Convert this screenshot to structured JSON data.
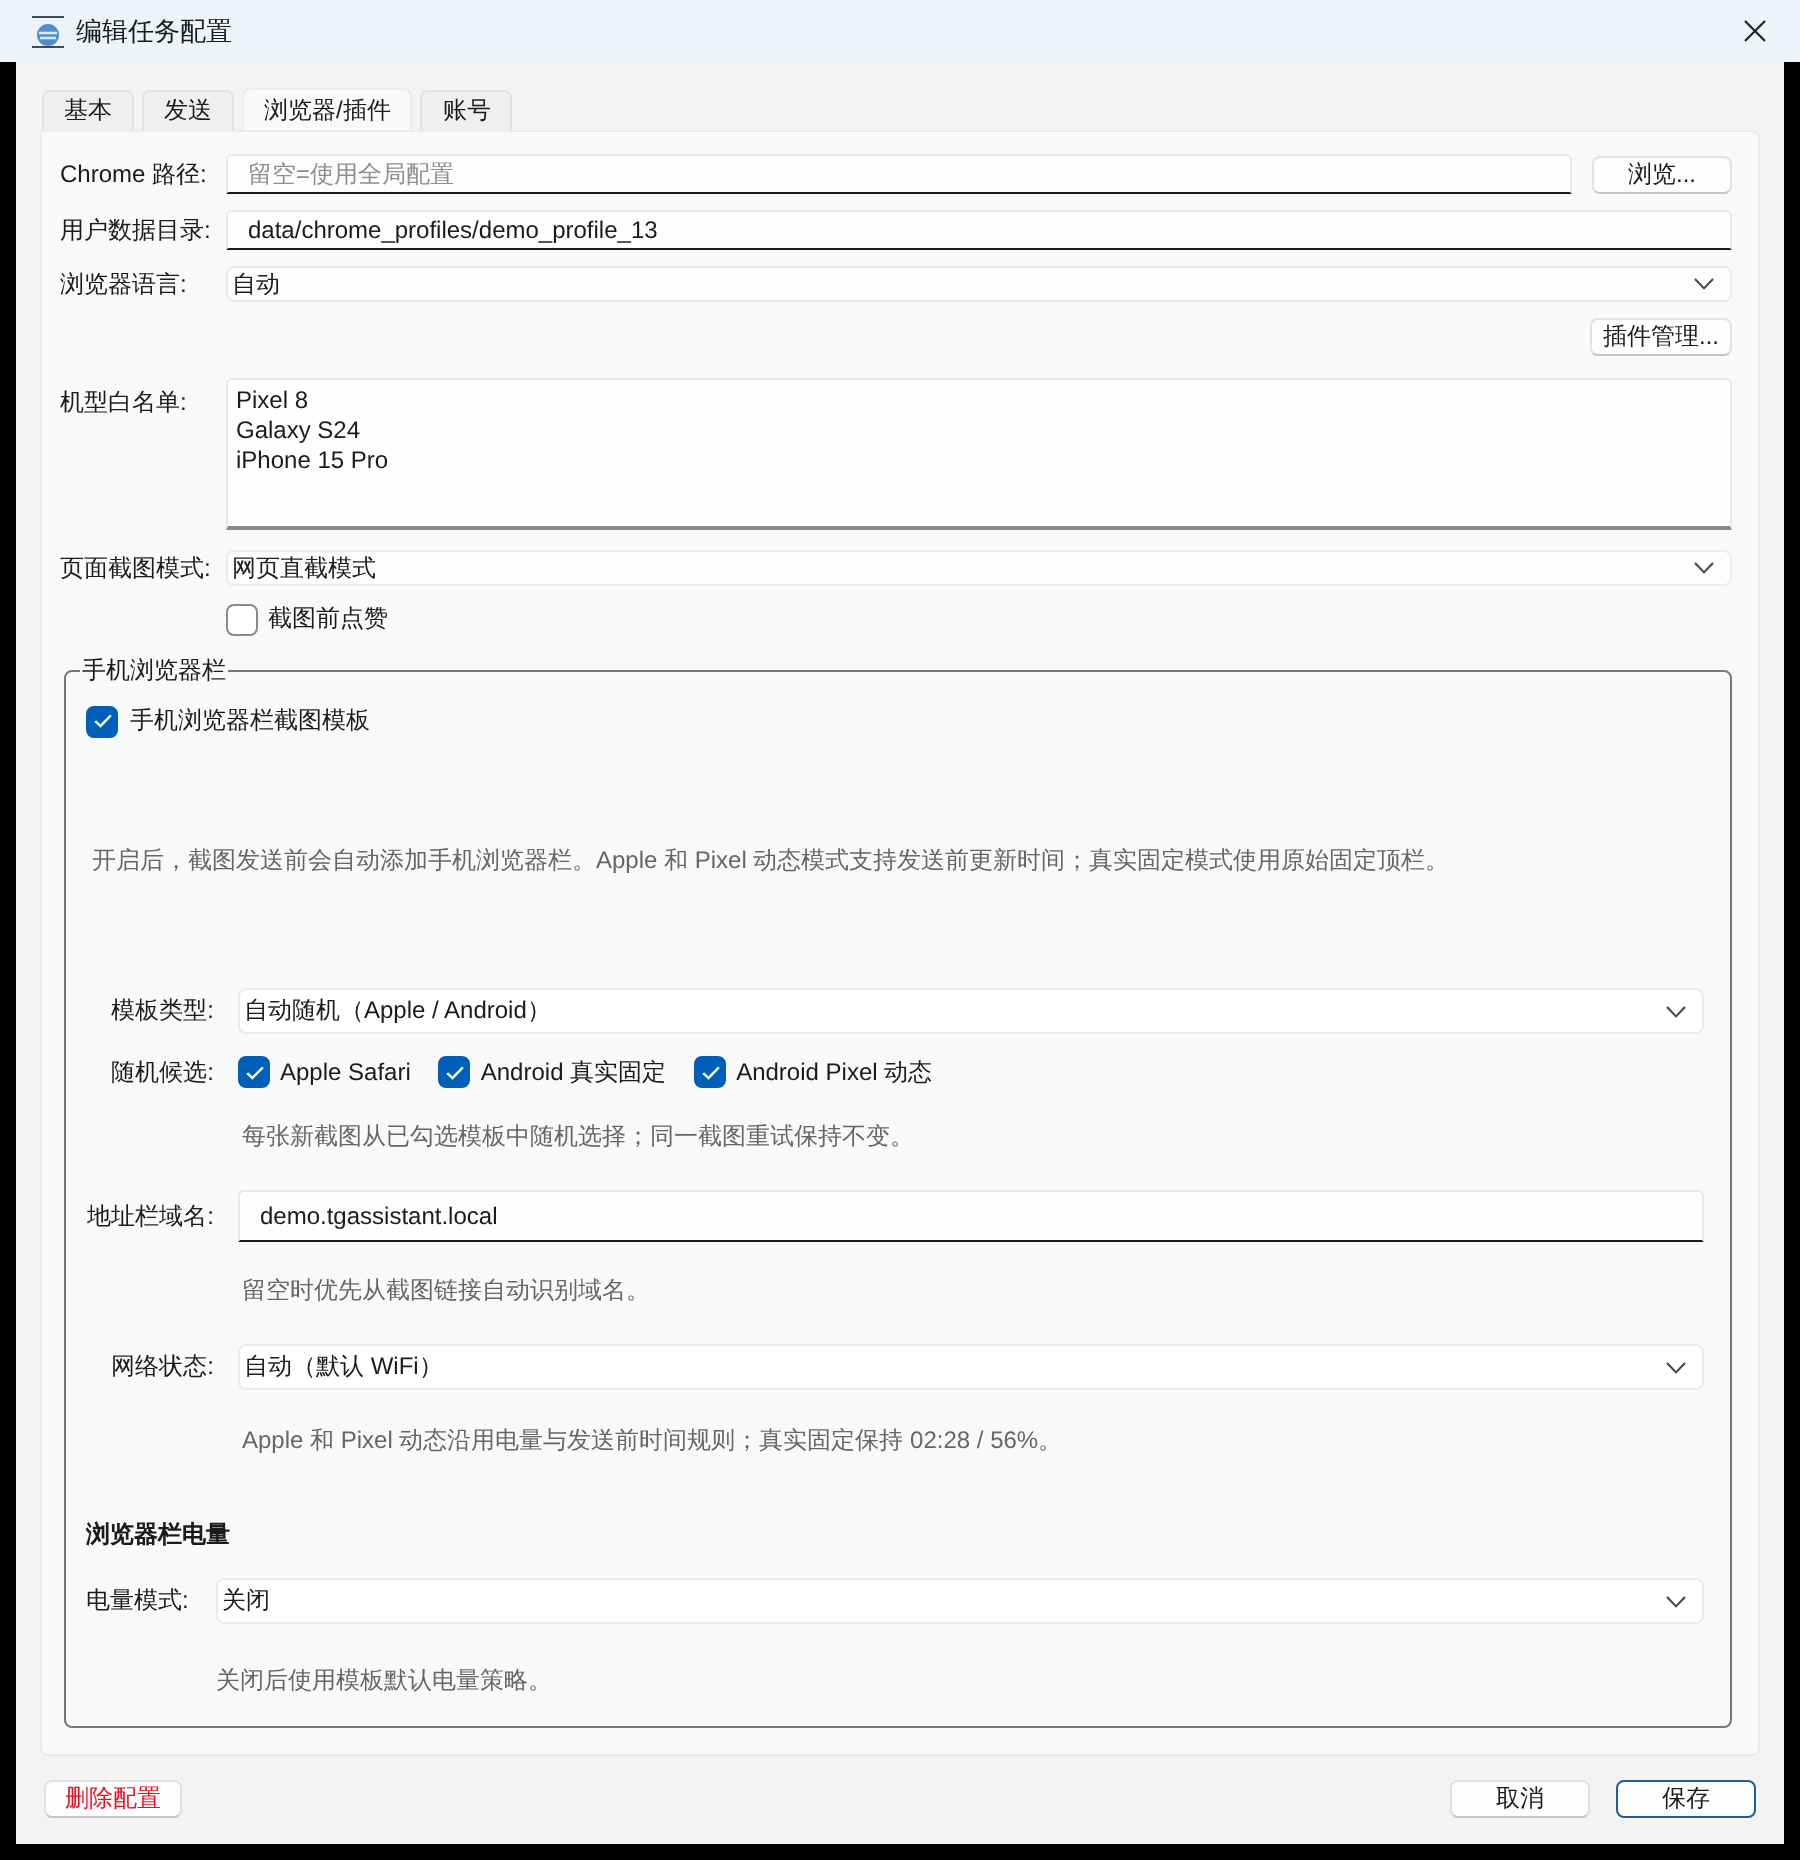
{
  "window": {
    "title": "编辑任务配置"
  },
  "tabs": [
    {
      "label": "基本",
      "selected": false
    },
    {
      "label": "发送",
      "selected": false
    },
    {
      "label": "浏览器/插件",
      "selected": true
    },
    {
      "label": "账号",
      "selected": false
    }
  ],
  "fields": [
    {
      "kind": "input",
      "label": "Chrome 路径:",
      "placeholder": "留空=使用全局配置",
      "button": "浏览..."
    },
    {
      "kind": "input",
      "label": "用户数据目录:",
      "value": "data/chrome_profiles/demo_profile_13"
    },
    {
      "kind": "select",
      "label": "浏览器语言:",
      "value": "自动"
    },
    {
      "kind": "button",
      "button": "插件管理..."
    },
    {
      "kind": "textarea",
      "label": "机型白名单:",
      "value": "Pixel 8\nGalaxy S24\niPhone 15 Pro"
    },
    {
      "kind": "select",
      "label": "页面截图模式:",
      "value": "网页直截模式"
    },
    {
      "kind": "checkbox",
      "label": "截图前点赞",
      "checked": false
    }
  ],
  "browser_bar": {
    "title": "手机浏览器栏",
    "enable": {
      "label": "手机浏览器栏截图模板",
      "checked": true
    },
    "description": "开启后，截图发送前会自动添加手机浏览器栏。Apple 和 Pixel 动态模式支持发送前更新时间；真实固定模式使用原始固定顶栏。",
    "rows": [
      {
        "kind": "select",
        "label": "模板类型:",
        "value": "自动随机（Apple / Android）"
      },
      {
        "kind": "checkboxes",
        "label": "随机候选:",
        "options": [
          {
            "label": "Apple Safari",
            "checked": true
          },
          {
            "label": "Android 真实固定",
            "checked": true
          },
          {
            "label": "Android Pixel 动态",
            "checked": true
          }
        ],
        "hint": "每张新截图从已勾选模板中随机选择；同一截图重试保持不变。"
      },
      {
        "kind": "input",
        "label": "地址栏域名:",
        "value": "demo.tgassistant.local",
        "hint": "留空时优先从截图链接自动识别域名。"
      },
      {
        "kind": "select",
        "label": "网络状态:",
        "value": "自动（默认 WiFi）",
        "hint": "Apple 和 Pixel 动态沿用电量与发送前时间规则；真实固定保持 02:28 / 56%。"
      }
    ],
    "battery": {
      "heading": "浏览器栏电量",
      "label": "电量模式:",
      "value": "关闭",
      "hint": "关闭后使用模板默认电量策略。"
    }
  },
  "footer": {
    "delete_button": "删除配置",
    "buttons": [
      {
        "label": "取消",
        "default": false
      },
      {
        "label": "保存",
        "default": true
      }
    ]
  }
}
